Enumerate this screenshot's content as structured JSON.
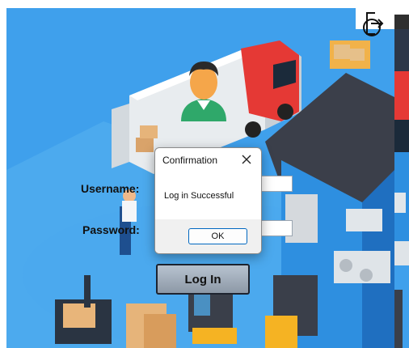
{
  "form": {
    "username_label": "Username:",
    "password_label": "Password:",
    "username_value": "",
    "password_value": "",
    "login_label": "Log In"
  },
  "dialog": {
    "title": "Confirmation",
    "message": "Log in Successful",
    "ok_label": "OK"
  },
  "icons": {
    "exit": "logout-icon",
    "close": "close-icon",
    "avatar": "user-avatar-icon"
  },
  "colors": {
    "background": "#3fa0ec",
    "truck": "#e53935",
    "avatar_shirt": "#2fa86a",
    "ok_border": "#0067c0"
  }
}
